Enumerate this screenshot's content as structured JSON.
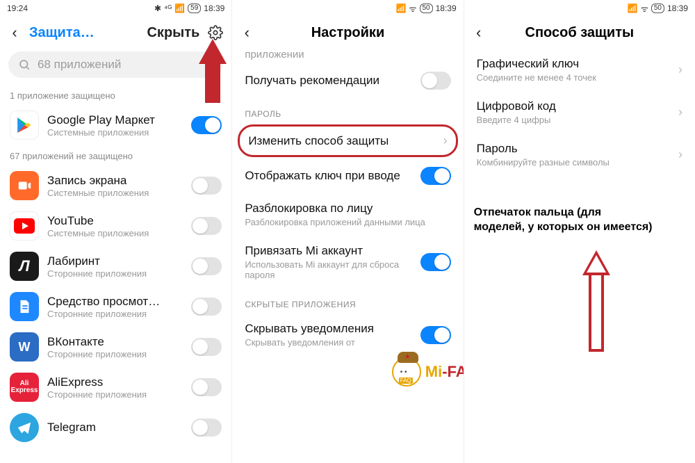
{
  "pane1": {
    "status": {
      "left": "19:24",
      "bt": "✱",
      "net": "⁴ᴳ",
      "sig": "📶",
      "bat": "59",
      "time": "18:39"
    },
    "header": {
      "title": "Защита…",
      "tab2": "Скрыть",
      "gear": "gear-icon"
    },
    "search": {
      "placeholder": "68 приложений"
    },
    "section_protected": "1 приложение защищено",
    "section_unprotected": "67 приложений не защищено",
    "apps_protected": [
      {
        "name": "Google Play Маркет",
        "sub": "Системные приложения",
        "icon": "play",
        "on": true
      }
    ],
    "apps_unprotected": [
      {
        "name": "Запись экрана",
        "sub": "Системные приложения",
        "icon": "rec",
        "on": false
      },
      {
        "name": "YouTube",
        "sub": "Системные приложения",
        "icon": "yt",
        "on": false
      },
      {
        "name": "Лабиринт",
        "sub": "Сторонние приложения",
        "icon": "lab",
        "on": false
      },
      {
        "name": "Средство просмот…",
        "sub": "Сторонние приложения",
        "icon": "doc",
        "on": false
      },
      {
        "name": "ВКонтакте",
        "sub": "Сторонние приложения",
        "icon": "vk",
        "on": false
      },
      {
        "name": "AliExpress",
        "sub": "Сторонние приложения",
        "icon": "ali",
        "on": false
      },
      {
        "name": "Telegram",
        "sub": "",
        "icon": "tg",
        "on": false
      }
    ]
  },
  "pane2": {
    "status": {
      "sig": "📶",
      "wifi": "ᯤ",
      "bat": "50",
      "time": "18:39"
    },
    "title": "Настройки",
    "partial_top": "приложении",
    "rows": {
      "recs": {
        "title": "Получать рекомендации",
        "on": false
      },
      "head_pass": "ПАРОЛЬ",
      "change": {
        "title": "Изменить способ защиты"
      },
      "showkey": {
        "title": "Отображать ключ при вводе",
        "on": true
      },
      "face": {
        "title": "Разблокировка по лицу",
        "sub": "Разблокировка приложений данными лица"
      },
      "mi": {
        "title": "Привязать Mi аккаунт",
        "sub": "Использовать Mi аккаунт для сброса пароля",
        "on": true
      },
      "head_hidden": "СКРЫТЫЕ ПРИЛОЖЕНИЯ",
      "hide_notif": {
        "title": "Скрывать уведомления",
        "sub": "Скрывать уведомления от",
        "on": true
      }
    }
  },
  "pane3": {
    "status": {
      "sig": "📶",
      "wifi": "ᯤ",
      "bat": "50",
      "time": "18:39"
    },
    "title": "Способ защиты",
    "rows": {
      "pattern": {
        "title": "Графический ключ",
        "sub": "Соедините не менее 4 точек"
      },
      "pin": {
        "title": "Цифровой код",
        "sub": "Введите 4 цифры"
      },
      "pwd": {
        "title": "Пароль",
        "sub": "Комбинируйте разные символы"
      }
    },
    "annotation": "Отпечаток пальца (для моделей, у которых он имеется)"
  },
  "logo": {
    "mi": "Mi",
    "rest": "-FAQ.RU"
  }
}
